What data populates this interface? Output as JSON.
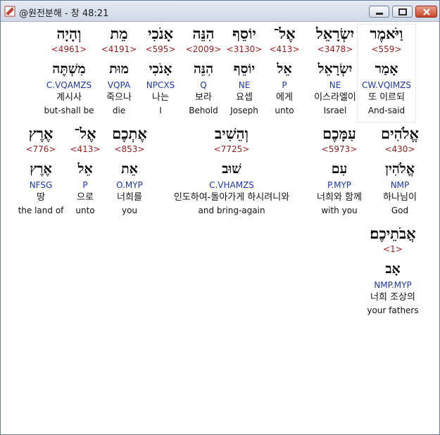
{
  "window": {
    "title": "@원전분해 - 창 48:21"
  },
  "colors": {
    "strong_number": "#9b1c1c",
    "morphology": "#1b35b8",
    "text": "#000000"
  },
  "verse": {
    "words": [
      {
        "hebrew": "וַיֹּאמֶר",
        "strong": "<559>",
        "lemma": "אָמַר",
        "morph": "CW.VQIMZS",
        "korean": "또 이르되",
        "english": "And-said"
      },
      {
        "hebrew": "יִשְׂרָאֵל",
        "strong": "<3478>",
        "lemma": "יִשְׂרָאֵל",
        "morph": "NE",
        "korean": "이스라엘이",
        "english": "Israel"
      },
      {
        "hebrew": "אֶל־",
        "strong": "<413>",
        "lemma": "אֵל",
        "morph": "P",
        "korean": "에게",
        "english": "unto"
      },
      {
        "hebrew": "יוֹסֵף",
        "strong": "<3130>",
        "lemma": "יוֹסֵף",
        "morph": "NE",
        "korean": "요셉",
        "english": "Joseph"
      },
      {
        "hebrew": "הִנֵּה",
        "strong": "<2009>",
        "lemma": "הִנֵּה",
        "morph": "Q",
        "korean": "보라",
        "english": "Behold"
      },
      {
        "hebrew": "אָנֹכִי",
        "strong": "<595>",
        "lemma": "אָנֹכִי",
        "morph": "NPCXS",
        "korean": "나는",
        "english": "I"
      },
      {
        "hebrew": "מֵת",
        "strong": "<4191>",
        "lemma": "מוּת",
        "morph": "VQPA",
        "korean": "죽으나",
        "english": "die"
      },
      {
        "hebrew": "וְהָיָה",
        "strong": "<4961>",
        "lemma": "מִשְׁתֶּה",
        "morph": "C.VQAMZS",
        "korean": "계시사",
        "english": "but-shall be"
      },
      {
        "hebrew": "אֱלֹהִים",
        "strong": "<430>",
        "lemma": "אֱלֹהִין",
        "morph": "NMP",
        "korean": "하나님이",
        "english": "God"
      },
      {
        "hebrew": "עִמָּכֶם",
        "strong": "<5973>",
        "lemma": "עִם",
        "morph": "P.MYP",
        "korean": "너희와 함께",
        "english": "with you"
      },
      {
        "hebrew": "וְהֵשִׁיב",
        "strong": "<7725>",
        "lemma": "שׁוּב",
        "morph": "C.VHAMZS",
        "korean": "인도하여-돌아가게 하시려니와",
        "english": "and bring-again"
      },
      {
        "hebrew": "אֶתְכֶם",
        "strong": "<853>",
        "lemma": "אֵת",
        "morph": "O.MYP",
        "korean": "너희를",
        "english": "you"
      },
      {
        "hebrew": "אֶל־",
        "strong": "<413>",
        "lemma": "אֵל",
        "morph": "P",
        "korean": "으로",
        "english": "unto"
      },
      {
        "hebrew": "אֶרֶץ",
        "strong": "<776>",
        "lemma": "אֶרֶץ",
        "morph": "NFSG",
        "korean": "땅",
        "english": "the land of"
      },
      {
        "hebrew": "אֲבֹתֵיכֶם׃",
        "strong": "<1>",
        "lemma": "אָב",
        "morph": "NMP.MYP",
        "korean": "너희 조상의",
        "english": "your fathers"
      }
    ]
  }
}
